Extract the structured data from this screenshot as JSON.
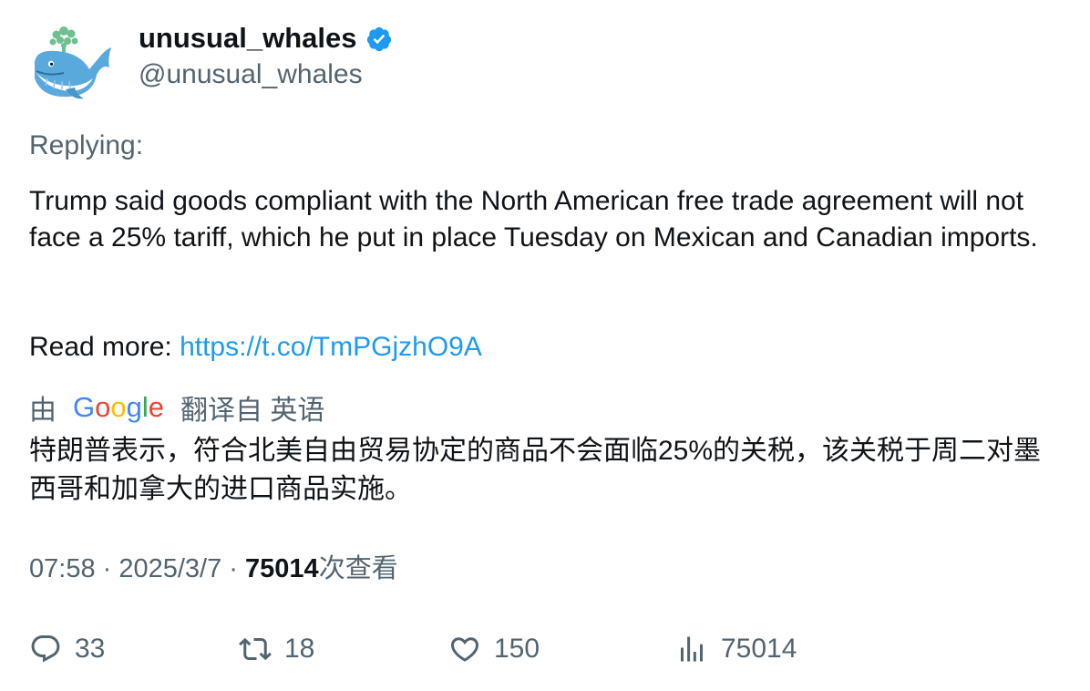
{
  "author": {
    "display_name": "unusual_whales",
    "handle": "@unusual_whales",
    "verified": true,
    "verified_color": "#1d9bf0"
  },
  "replying_label": "Replying:",
  "body": {
    "text": "Trump said goods compliant with the North American free trade agreement will not face a 25% tariff, which he put in place Tuesday on Mexican and Canadian imports.",
    "read_more_label": "Read more: ",
    "link": "https://t.co/TmPGjzhO9A"
  },
  "translation": {
    "by_label": "由",
    "provider": "Google",
    "from_label": "翻译自 英语",
    "text": "特朗普表示，符合北美自由贸易协定的商品不会面临25%的关税，该关税于周二对墨西哥和加拿大的进口商品实施。"
  },
  "meta": {
    "time": "07:58",
    "separator": " · ",
    "date": "2025/3/7",
    "views_count": "75014",
    "views_label": "次查看"
  },
  "actions": {
    "replies": "33",
    "retweets": "18",
    "likes": "150",
    "views": "75014"
  },
  "colors": {
    "text_primary": "#0f1419",
    "text_secondary": "#536471",
    "link": "#1d9bf0",
    "avatar_whale": "#5aa9dd",
    "avatar_spout": "#6fbf8f"
  }
}
